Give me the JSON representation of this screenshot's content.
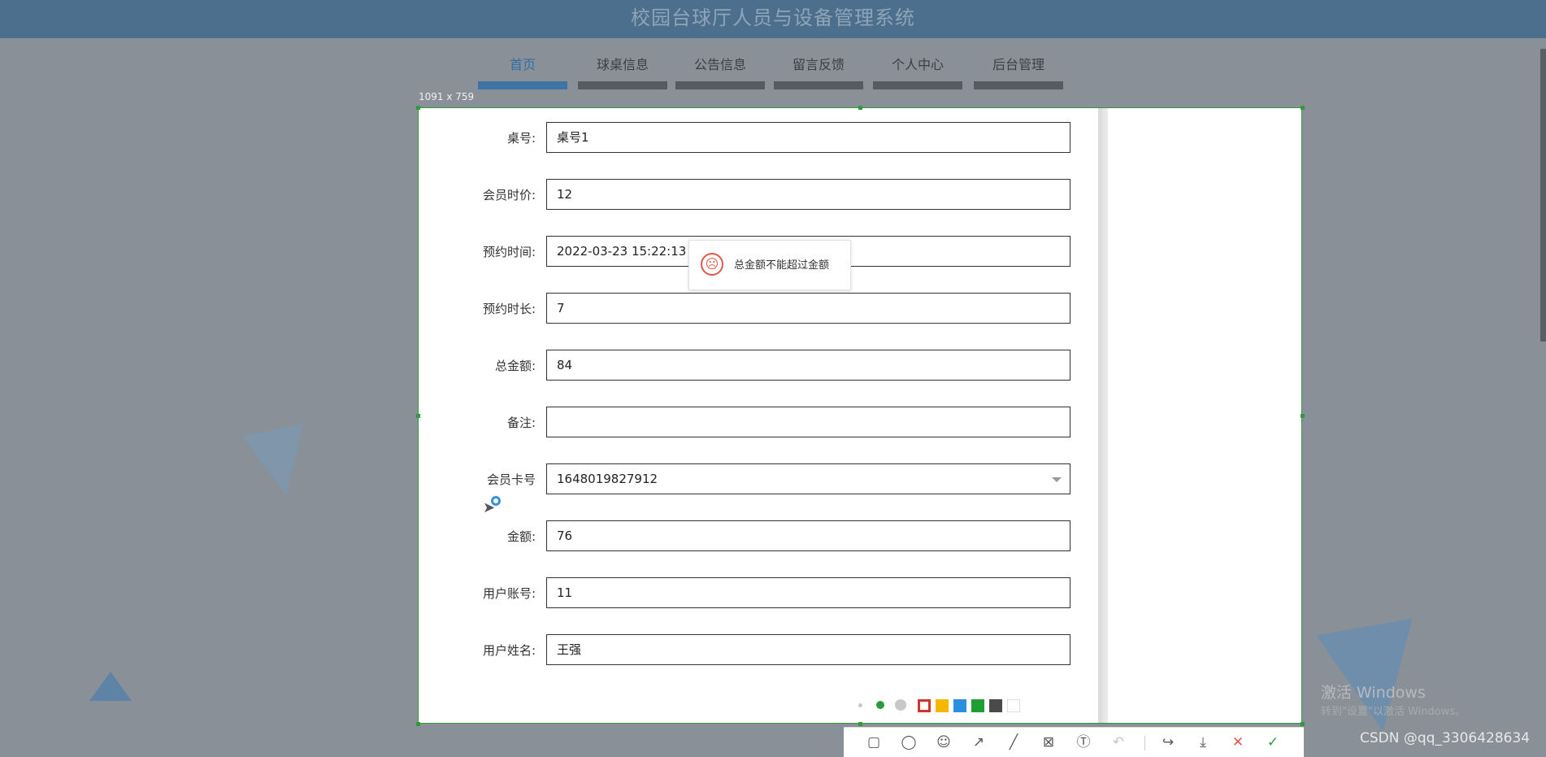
{
  "app": {
    "title": "校园台球厅人员与设备管理系统"
  },
  "nav": {
    "items": [
      {
        "label": "首页",
        "active": true
      },
      {
        "label": "球桌信息"
      },
      {
        "label": "公告信息"
      },
      {
        "label": "留言反馈"
      },
      {
        "label": "个人中心"
      },
      {
        "label": "后台管理"
      }
    ]
  },
  "capture": {
    "dimensions": "1091 x 759"
  },
  "form": {
    "fields": [
      {
        "label": "桌号:",
        "value": "桌号1"
      },
      {
        "label": "会员时价:",
        "value": "12"
      },
      {
        "label": "预约时间:",
        "value": "2022-03-23 15:22:13"
      },
      {
        "label": "预约时长:",
        "value": "7"
      },
      {
        "label": "总金额:",
        "value": "84"
      },
      {
        "label": "备注:",
        "value": ""
      },
      {
        "label": "会员卡号",
        "value": "1648019827912",
        "type": "select"
      },
      {
        "label": "金额:",
        "value": "76"
      },
      {
        "label": "用户账号:",
        "value": "11"
      },
      {
        "label": "用户姓名:",
        "value": "王强"
      }
    ]
  },
  "toast": {
    "message": "总金额不能超过金额",
    "icon": "sad-face-icon"
  },
  "annotation": {
    "colors": [
      "#d0342c",
      "#f5b800",
      "#2a8fe0",
      "#1f9e35",
      "#4a4a4a",
      "#ffffff"
    ],
    "save_label": "保存"
  },
  "toolbar": {
    "tools": [
      "rectangle-icon",
      "ellipse-icon",
      "emoji-icon",
      "arrow-icon",
      "pen-icon",
      "mosaic-icon",
      "text-icon",
      "undo-icon",
      "share-icon",
      "download-icon",
      "cancel-icon",
      "confirm-icon"
    ]
  },
  "watermark": {
    "line1": "激活 Windows",
    "line2": "转到\"设置\"以激活 Windows。"
  },
  "credit": "CSDN @qq_3306428634"
}
